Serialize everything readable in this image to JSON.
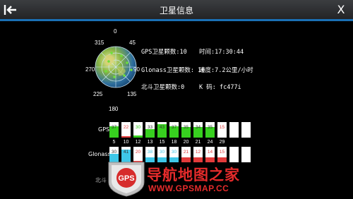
{
  "header": {
    "title": "卫星信息",
    "back_icon": "back-arrow-icon",
    "close_label": "X"
  },
  "skyplot": {
    "directions": [
      "0",
      "45",
      "90",
      "135",
      "180",
      "225",
      "270",
      "315"
    ]
  },
  "info": {
    "gps_count": "GPS卫星颗数:10",
    "time": "时间:17:30:44",
    "glonass_count": "Glonass卫星颗数: 10",
    "speed": "速度:7.2公里/小时",
    "beidou_count": "北斗卫星颗数:0",
    "k_code": "K 码:  fc477i"
  },
  "gps": {
    "label": "GPS",
    "sats": [
      {
        "snr": "37",
        "prn": "5",
        "color": "#37d01f",
        "level": 0.75
      },
      {
        "snr": "22",
        "prn": "10",
        "color": "#e23b3b",
        "level": 0.1
      },
      {
        "snr": "30",
        "prn": "12",
        "color": "#37d01f",
        "level": 0.15
      },
      {
        "snr": "33",
        "prn": "13",
        "color": "#37d01f",
        "level": 0.55
      },
      {
        "snr": "43",
        "prn": "15",
        "color": "#37d01f",
        "level": 0.85
      },
      {
        "snr": "37",
        "prn": "18",
        "color": "#37d01f",
        "level": 0.75
      },
      {
        "snr": "35",
        "prn": "20",
        "color": "#37d01f",
        "level": 0.7
      },
      {
        "snr": "34",
        "prn": "21",
        "color": "#37d01f",
        "level": 0.7
      },
      {
        "snr": "35",
        "prn": "24",
        "color": "#37d01f",
        "level": 0.7
      },
      {
        "snr": "15",
        "prn": "29",
        "color": "#e23b3b",
        "level": 0.0
      },
      {
        "snr": "",
        "prn": "",
        "color": "#ffffff",
        "level": 0.0
      },
      {
        "snr": "",
        "prn": "",
        "color": "#ffffff",
        "level": 0.0
      }
    ]
  },
  "glonass": {
    "label": "Glonass",
    "sats": [
      {
        "snr": "30",
        "color": "#3ec7e8",
        "level": 0.55
      },
      {
        "snr": "41",
        "color": "#3ec7e8",
        "level": 0.8
      },
      {
        "snr": "20",
        "color": "#e23b3b",
        "level": 0.1
      },
      {
        "snr": "38",
        "color": "#3ec7e8",
        "level": 0.3
      },
      {
        "snr": "30",
        "color": "#3ec7e8",
        "level": 0.3
      },
      {
        "snr": "30",
        "color": "#3ec7e8",
        "level": 0.3
      },
      {
        "snr": "21",
        "color": "#e23b3b",
        "level": 0.3
      },
      {
        "snr": "12",
        "color": "#e23b3b",
        "level": 0.3
      },
      {
        "snr": "14",
        "color": "#e23b3b",
        "level": 0.3
      },
      {
        "snr": "15",
        "color": "#e23b3b",
        "level": 0.3
      },
      {
        "snr": "",
        "color": "#ffffff",
        "level": 0.0
      },
      {
        "snr": "",
        "color": "#ffffff",
        "level": 0.0
      }
    ]
  },
  "beidou": {
    "label": "北斗"
  },
  "watermark": {
    "logo": "GPS",
    "text": "导航地图之家",
    "url": "WWW.GPSMAP.CC"
  }
}
